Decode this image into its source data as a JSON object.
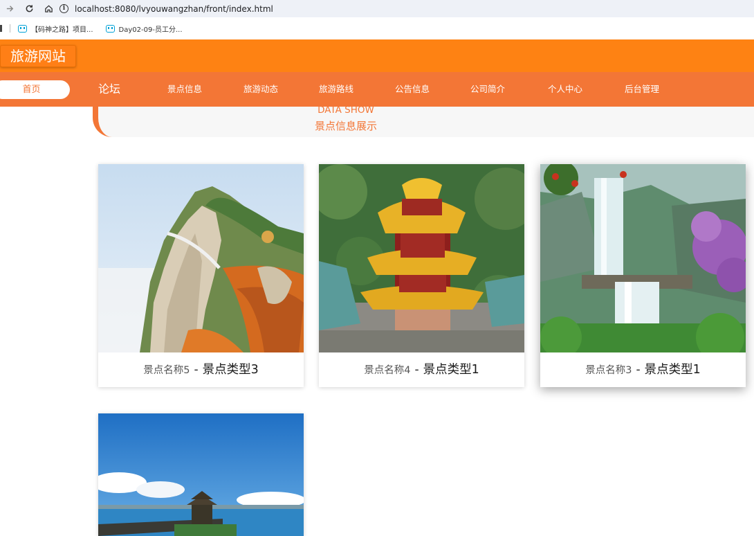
{
  "browser": {
    "url_host": "localhost",
    "url_rest": ":8080/lvyouwangzhan/front/index.html",
    "bookmarks": [
      {
        "label": "【码神之路】项目..."
      },
      {
        "label": "Day02-09-员工分..."
      }
    ]
  },
  "site": {
    "logo": "旅游网站",
    "nav": [
      {
        "label": "首页",
        "active": true
      },
      {
        "label": "论坛"
      },
      {
        "label": "景点信息"
      },
      {
        "label": "旅游动态"
      },
      {
        "label": "旅游路线"
      },
      {
        "label": "公告信息"
      },
      {
        "label": "公司简介"
      },
      {
        "label": "个人中心"
      },
      {
        "label": "后台管理"
      }
    ]
  },
  "section": {
    "title_en": "DATA SHOW",
    "title_cn": "景点信息展示"
  },
  "cards": [
    {
      "name": "景点名称5",
      "sep": "-",
      "type": "景点类型3",
      "image": "mountain-cliff-path-photo"
    },
    {
      "name": "景点名称4",
      "sep": "-",
      "type": "景点类型1",
      "image": "yellow-pavilion-tower-photo"
    },
    {
      "name": "景点名称3",
      "sep": "-",
      "type": "景点类型1",
      "image": "waterfall-photo"
    },
    {
      "image": "seaside-pavilion-pier-photo"
    }
  ],
  "colors": {
    "header": "#fe8213",
    "nav": "#f37636",
    "accent": "#f37636"
  }
}
